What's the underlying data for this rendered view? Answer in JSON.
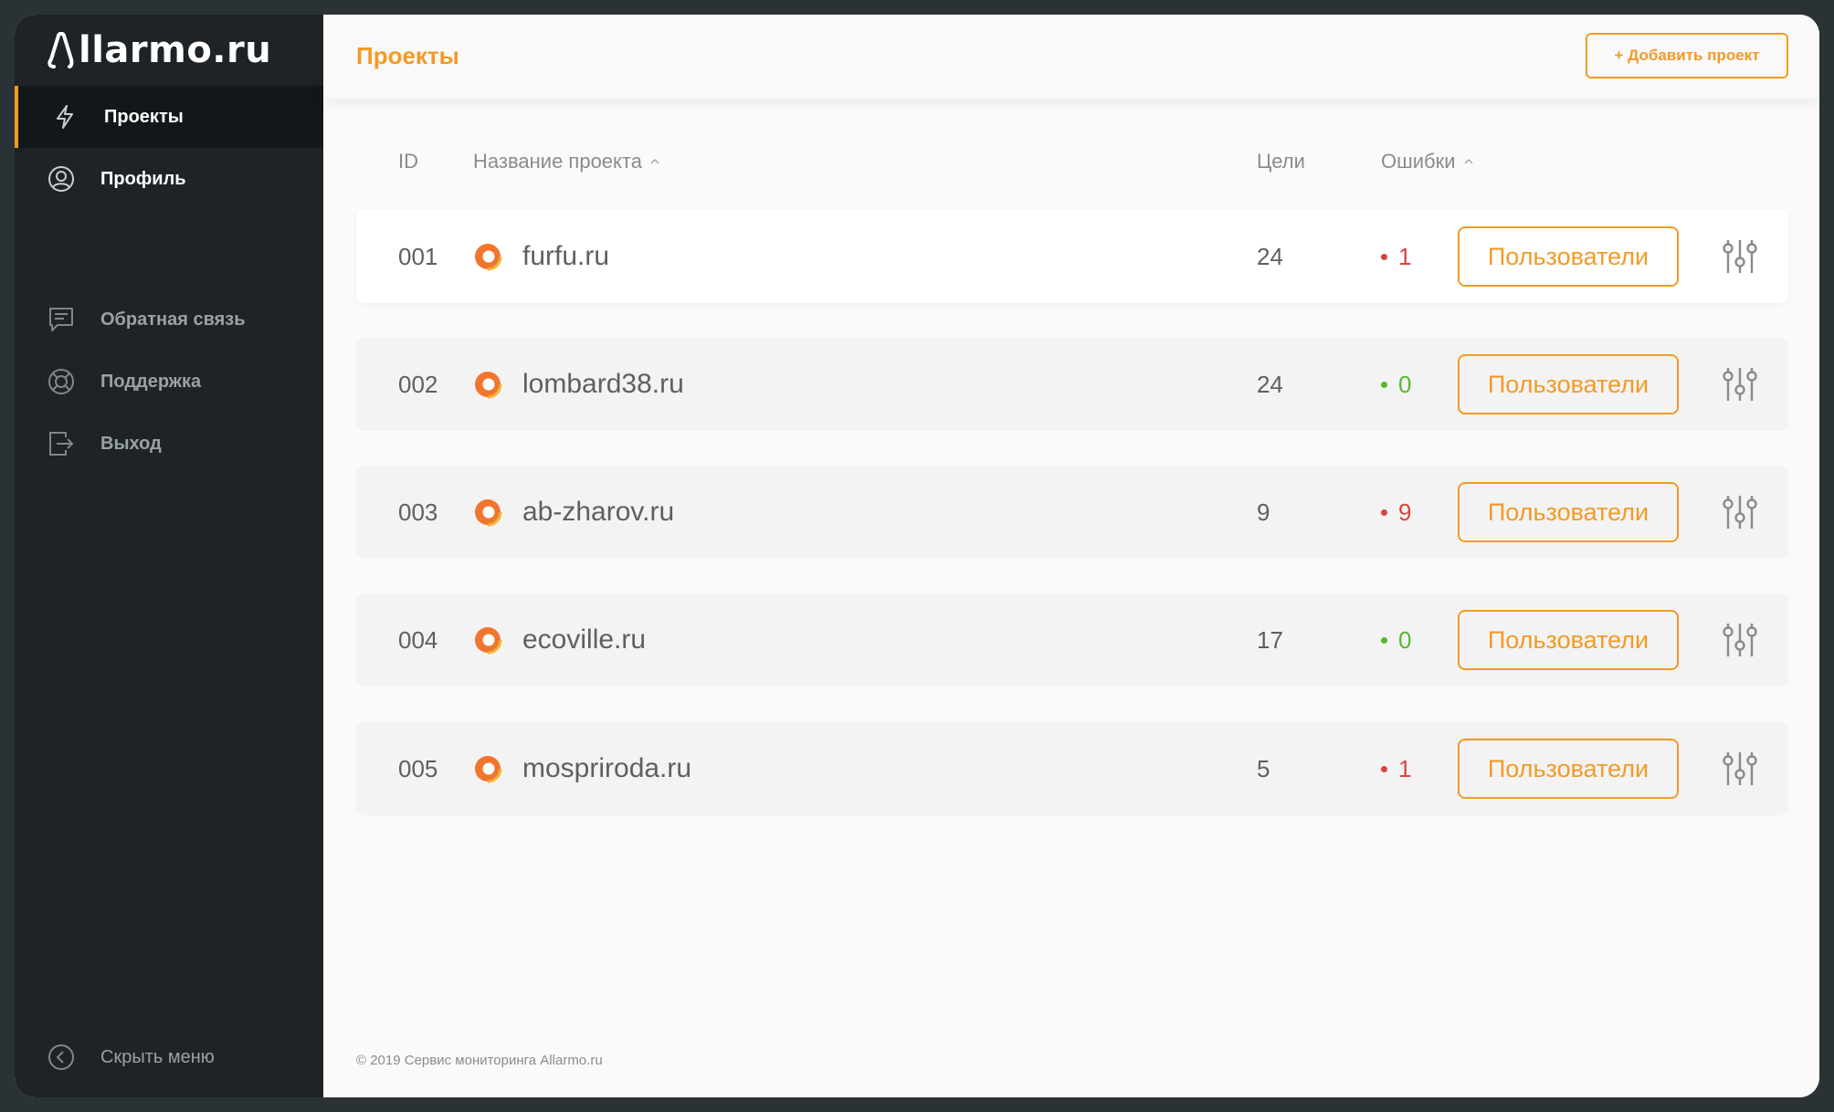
{
  "brand": {
    "logo_text": "llarmo.ru",
    "accent": "#f39a27"
  },
  "sidebar": {
    "primary": [
      {
        "label": "Проекты",
        "icon": "bolt-icon",
        "active": true
      },
      {
        "label": "Профиль",
        "icon": "user-circle-icon",
        "active": false
      }
    ],
    "secondary": [
      {
        "label": "Обратная связь",
        "icon": "chat-icon"
      },
      {
        "label": "Поддержка",
        "icon": "lifebuoy-icon"
      },
      {
        "label": "Выход",
        "icon": "logout-icon"
      }
    ],
    "collapse_label": "Скрыть меню"
  },
  "header": {
    "title": "Проекты",
    "add_button": "+ Добавить проект"
  },
  "table": {
    "columns": {
      "id": "ID",
      "name": "Название проекта",
      "goals": "Цели",
      "errors": "Ошибки"
    },
    "rows": [
      {
        "id": "001",
        "name": "furfu.ru",
        "goals": "24",
        "errors": "1",
        "error_status": "bad",
        "users_label": "Пользователи"
      },
      {
        "id": "002",
        "name": "lombard38.ru",
        "goals": "24",
        "errors": "0",
        "error_status": "ok",
        "users_label": "Пользователи"
      },
      {
        "id": "003",
        "name": "ab-zharov.ru",
        "goals": "9",
        "errors": "9",
        "error_status": "bad",
        "users_label": "Пользователи"
      },
      {
        "id": "004",
        "name": "ecoville.ru",
        "goals": "17",
        "errors": "0",
        "error_status": "ok",
        "users_label": "Пользователи"
      },
      {
        "id": "005",
        "name": "mospriroda.ru",
        "goals": "5",
        "errors": "1",
        "error_status": "bad",
        "users_label": "Пользователи"
      }
    ],
    "status_colors": {
      "bad": "#d6453c",
      "ok": "#58b82e"
    }
  },
  "footer": {
    "copyright": "© 2019 Сервис мониторинга Allarmo.ru"
  }
}
